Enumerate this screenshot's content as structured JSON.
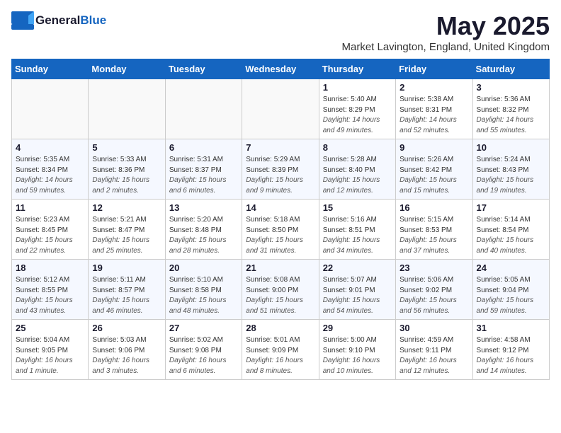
{
  "header": {
    "logo_general": "General",
    "logo_blue": "Blue",
    "title": "May 2025",
    "location": "Market Lavington, England, United Kingdom"
  },
  "weekdays": [
    "Sunday",
    "Monday",
    "Tuesday",
    "Wednesday",
    "Thursday",
    "Friday",
    "Saturday"
  ],
  "weeks": [
    [
      {
        "day": "",
        "info": ""
      },
      {
        "day": "",
        "info": ""
      },
      {
        "day": "",
        "info": ""
      },
      {
        "day": "",
        "info": ""
      },
      {
        "day": "1",
        "sunrise": "5:40 AM",
        "sunset": "8:29 PM",
        "daylight": "14 hours and 49 minutes."
      },
      {
        "day": "2",
        "sunrise": "5:38 AM",
        "sunset": "8:31 PM",
        "daylight": "14 hours and 52 minutes."
      },
      {
        "day": "3",
        "sunrise": "5:36 AM",
        "sunset": "8:32 PM",
        "daylight": "14 hours and 55 minutes."
      }
    ],
    [
      {
        "day": "4",
        "sunrise": "5:35 AM",
        "sunset": "8:34 PM",
        "daylight": "14 hours and 59 minutes."
      },
      {
        "day": "5",
        "sunrise": "5:33 AM",
        "sunset": "8:36 PM",
        "daylight": "15 hours and 2 minutes."
      },
      {
        "day": "6",
        "sunrise": "5:31 AM",
        "sunset": "8:37 PM",
        "daylight": "15 hours and 6 minutes."
      },
      {
        "day": "7",
        "sunrise": "5:29 AM",
        "sunset": "8:39 PM",
        "daylight": "15 hours and 9 minutes."
      },
      {
        "day": "8",
        "sunrise": "5:28 AM",
        "sunset": "8:40 PM",
        "daylight": "15 hours and 12 minutes."
      },
      {
        "day": "9",
        "sunrise": "5:26 AM",
        "sunset": "8:42 PM",
        "daylight": "15 hours and 15 minutes."
      },
      {
        "day": "10",
        "sunrise": "5:24 AM",
        "sunset": "8:43 PM",
        "daylight": "15 hours and 19 minutes."
      }
    ],
    [
      {
        "day": "11",
        "sunrise": "5:23 AM",
        "sunset": "8:45 PM",
        "daylight": "15 hours and 22 minutes."
      },
      {
        "day": "12",
        "sunrise": "5:21 AM",
        "sunset": "8:47 PM",
        "daylight": "15 hours and 25 minutes."
      },
      {
        "day": "13",
        "sunrise": "5:20 AM",
        "sunset": "8:48 PM",
        "daylight": "15 hours and 28 minutes."
      },
      {
        "day": "14",
        "sunrise": "5:18 AM",
        "sunset": "8:50 PM",
        "daylight": "15 hours and 31 minutes."
      },
      {
        "day": "15",
        "sunrise": "5:16 AM",
        "sunset": "8:51 PM",
        "daylight": "15 hours and 34 minutes."
      },
      {
        "day": "16",
        "sunrise": "5:15 AM",
        "sunset": "8:53 PM",
        "daylight": "15 hours and 37 minutes."
      },
      {
        "day": "17",
        "sunrise": "5:14 AM",
        "sunset": "8:54 PM",
        "daylight": "15 hours and 40 minutes."
      }
    ],
    [
      {
        "day": "18",
        "sunrise": "5:12 AM",
        "sunset": "8:55 PM",
        "daylight": "15 hours and 43 minutes."
      },
      {
        "day": "19",
        "sunrise": "5:11 AM",
        "sunset": "8:57 PM",
        "daylight": "15 hours and 46 minutes."
      },
      {
        "day": "20",
        "sunrise": "5:10 AM",
        "sunset": "8:58 PM",
        "daylight": "15 hours and 48 minutes."
      },
      {
        "day": "21",
        "sunrise": "5:08 AM",
        "sunset": "9:00 PM",
        "daylight": "15 hours and 51 minutes."
      },
      {
        "day": "22",
        "sunrise": "5:07 AM",
        "sunset": "9:01 PM",
        "daylight": "15 hours and 54 minutes."
      },
      {
        "day": "23",
        "sunrise": "5:06 AM",
        "sunset": "9:02 PM",
        "daylight": "15 hours and 56 minutes."
      },
      {
        "day": "24",
        "sunrise": "5:05 AM",
        "sunset": "9:04 PM",
        "daylight": "15 hours and 59 minutes."
      }
    ],
    [
      {
        "day": "25",
        "sunrise": "5:04 AM",
        "sunset": "9:05 PM",
        "daylight": "16 hours and 1 minute."
      },
      {
        "day": "26",
        "sunrise": "5:03 AM",
        "sunset": "9:06 PM",
        "daylight": "16 hours and 3 minutes."
      },
      {
        "day": "27",
        "sunrise": "5:02 AM",
        "sunset": "9:08 PM",
        "daylight": "16 hours and 6 minutes."
      },
      {
        "day": "28",
        "sunrise": "5:01 AM",
        "sunset": "9:09 PM",
        "daylight": "16 hours and 8 minutes."
      },
      {
        "day": "29",
        "sunrise": "5:00 AM",
        "sunset": "9:10 PM",
        "daylight": "16 hours and 10 minutes."
      },
      {
        "day": "30",
        "sunrise": "4:59 AM",
        "sunset": "9:11 PM",
        "daylight": "16 hours and 12 minutes."
      },
      {
        "day": "31",
        "sunrise": "4:58 AM",
        "sunset": "9:12 PM",
        "daylight": "16 hours and 14 minutes."
      }
    ]
  ]
}
